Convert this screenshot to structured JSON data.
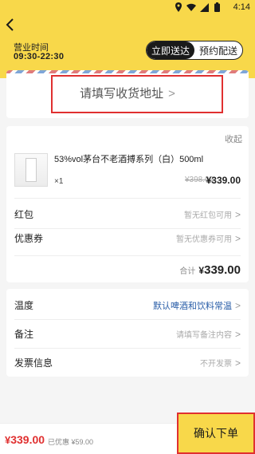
{
  "status_bar": {
    "time": "4:14"
  },
  "header": {
    "hours_label": "营业时间",
    "hours_value": "09:30-22:30",
    "delivery_options": [
      "立即送达",
      "预约配送"
    ],
    "active_option": "立即送达",
    "accent_color": "#f8d84a"
  },
  "address": {
    "placeholder": "请填写收货地址",
    "chevron": ">"
  },
  "goods": {
    "collapse_label": "收起",
    "product_name": "53%vol茅台不老酒搏系列（白）500ml",
    "quantity": "×1",
    "original_price": "¥398.00",
    "current_price": "¥339.00"
  },
  "coupons": {
    "red_packet_label": "红包",
    "red_packet_value": "暂无红包可用",
    "coupon_label": "优惠券",
    "coupon_value": "暂无优惠券可用"
  },
  "subtotal": {
    "label": "合计",
    "currency": "¥",
    "amount": "339.00"
  },
  "settings": {
    "temperature_label": "温度",
    "temperature_value": "默认啤酒和饮料常温",
    "note_label": "备注",
    "note_value": "请填写备注内容",
    "invoice_label": "发票信息",
    "invoice_value": "不开发票"
  },
  "footer": {
    "pay_currency": "¥",
    "pay_amount": "339.00",
    "saved_text": "已优惠 ¥59.00",
    "confirm_label": "确认下单",
    "highlight_color": "#e03030"
  }
}
